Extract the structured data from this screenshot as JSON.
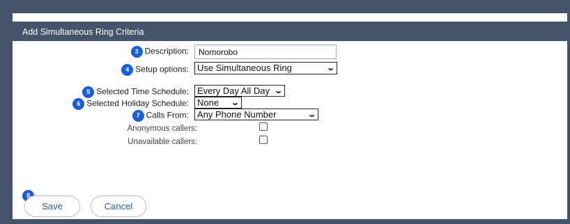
{
  "header": {
    "title": "Add Simultaneous Ring Criteria"
  },
  "form": {
    "description": {
      "badge": "3",
      "label": "Description:",
      "value": "Nomorobo"
    },
    "setup_options": {
      "badge": "4",
      "label": "Setup options:",
      "value": "Use Simultaneous Ring"
    },
    "time_schedule": {
      "badge": "5",
      "label": "Selected Time Schedule:",
      "value": "Every Day All Day"
    },
    "holiday_schedule": {
      "badge": "6",
      "label": "Selected Holiday Schedule:",
      "value": "None"
    },
    "calls_from": {
      "badge": "7",
      "label": "Calls From:",
      "value": "Any Phone Number"
    },
    "anonymous": {
      "label": "Anonymous callers:",
      "checked": false
    },
    "unavailable": {
      "label": "Unavailable callers:",
      "checked": false
    }
  },
  "buttons": {
    "badge": "8",
    "save": "Save",
    "cancel": "Cancel"
  },
  "colors": {
    "header_bg": "#45546a",
    "badge": "#1b5fd8",
    "button_text": "#2a5aa8"
  }
}
